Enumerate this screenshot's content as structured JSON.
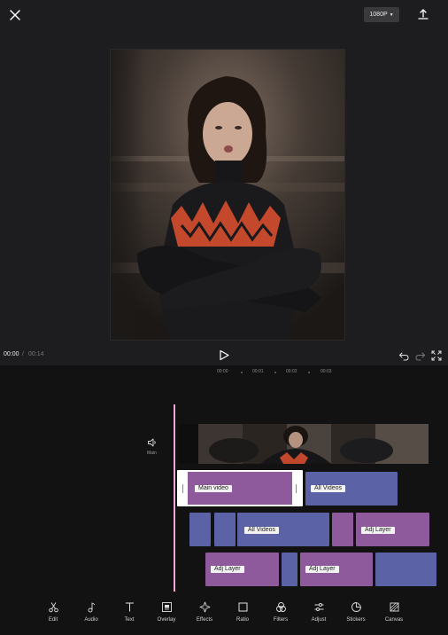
{
  "header": {
    "resolution_label": "1080P",
    "close_icon": "close-icon",
    "export_icon": "export-icon"
  },
  "playback": {
    "current_time": "00:00",
    "separator": "/",
    "total_time": "00:14"
  },
  "ruler": {
    "ticks": [
      "00:00",
      "00:01",
      "00:02",
      "00:03"
    ]
  },
  "track_header": {
    "label": "Main"
  },
  "clips": {
    "main_video_label": "Main video",
    "all_videos_1": "All Videos",
    "all_videos_2": "All Videos",
    "adj_layer_1": "Adj Layer",
    "adj_layer_2": "Adj Layer",
    "adj_layer_3": "Adj Layer"
  },
  "colors": {
    "clip_purple": "#8e5a9c",
    "clip_blue": "#5b63a6",
    "playhead": "#f4a6d4"
  },
  "toolbar": {
    "items": [
      {
        "label": "Edit",
        "icon": "scissors-icon"
      },
      {
        "label": "Audio",
        "icon": "music-note-icon"
      },
      {
        "label": "Text",
        "icon": "text-icon"
      },
      {
        "label": "Overlay",
        "icon": "overlay-icon"
      },
      {
        "label": "Effects",
        "icon": "sparkle-icon"
      },
      {
        "label": "Ratio",
        "icon": "square-icon"
      },
      {
        "label": "Filters",
        "icon": "filters-icon"
      },
      {
        "label": "Adjust",
        "icon": "sliders-icon"
      },
      {
        "label": "Stickers",
        "icon": "sticker-icon"
      },
      {
        "label": "Canvas",
        "icon": "canvas-icon"
      }
    ]
  }
}
